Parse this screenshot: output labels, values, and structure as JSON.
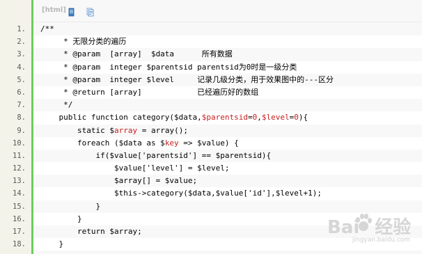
{
  "toolbar": {
    "lang_label": "[html]",
    "view_source_icon": "view-source-icon",
    "copy_icon": "copy-icon"
  },
  "code": {
    "lines": [
      {
        "n": "1.",
        "segs": [
          {
            "t": "/**",
            "c": ""
          }
        ]
      },
      {
        "n": "2.",
        "segs": [
          {
            "t": "     * 无限分类的遍历",
            "c": ""
          }
        ]
      },
      {
        "n": "3.",
        "segs": [
          {
            "t": "     * @param  [array]  $data      所有数据",
            "c": ""
          }
        ]
      },
      {
        "n": "4.",
        "segs": [
          {
            "t": "     * @param  integer $parentsid parentsid为0时是一级分类",
            "c": ""
          }
        ]
      },
      {
        "n": "5.",
        "segs": [
          {
            "t": "     * @param  integer $level     记录几级分类，用于效果图中的---区分",
            "c": ""
          }
        ]
      },
      {
        "n": "6.",
        "segs": [
          {
            "t": "     * @return [array]            已经遍历好的数组",
            "c": ""
          }
        ]
      },
      {
        "n": "7.",
        "segs": [
          {
            "t": "     */",
            "c": ""
          }
        ]
      },
      {
        "n": "8.",
        "segs": [
          {
            "t": "    public function category($data,",
            "c": ""
          },
          {
            "t": "$parentsid",
            "c": "red"
          },
          {
            "t": "=",
            "c": ""
          },
          {
            "t": "0",
            "c": "red"
          },
          {
            "t": ",",
            "c": ""
          },
          {
            "t": "$level",
            "c": "red"
          },
          {
            "t": "=",
            "c": ""
          },
          {
            "t": "0",
            "c": "red"
          },
          {
            "t": "){",
            "c": ""
          }
        ]
      },
      {
        "n": "9.",
        "segs": [
          {
            "t": "        static $",
            "c": ""
          },
          {
            "t": "array",
            "c": "red"
          },
          {
            "t": " = array();",
            "c": ""
          }
        ]
      },
      {
        "n": "10.",
        "segs": [
          {
            "t": "        foreach ($data as $",
            "c": ""
          },
          {
            "t": "key",
            "c": "red"
          },
          {
            "t": " => $value) {",
            "c": ""
          }
        ]
      },
      {
        "n": "11.",
        "segs": [
          {
            "t": "            if($value['parentsid'] == $parentsid){",
            "c": ""
          }
        ]
      },
      {
        "n": "12.",
        "segs": [
          {
            "t": "                $value['level'] = $level;",
            "c": ""
          }
        ]
      },
      {
        "n": "13.",
        "segs": [
          {
            "t": "                $array[] = $value;",
            "c": ""
          }
        ]
      },
      {
        "n": "14.",
        "segs": [
          {
            "t": "                $this->category($data,$value['id'],$level+1);",
            "c": ""
          }
        ]
      },
      {
        "n": "15.",
        "segs": [
          {
            "t": "            }",
            "c": ""
          }
        ]
      },
      {
        "n": "16.",
        "segs": [
          {
            "t": "        }",
            "c": ""
          }
        ]
      },
      {
        "n": "17.",
        "segs": [
          {
            "t": "        return $array;",
            "c": ""
          }
        ]
      },
      {
        "n": "18.",
        "segs": [
          {
            "t": "    }",
            "c": ""
          }
        ]
      }
    ]
  },
  "watermark": {
    "brand": "Bai",
    "brand_suffix": "经验",
    "url": "jingyan.baidu.com"
  }
}
